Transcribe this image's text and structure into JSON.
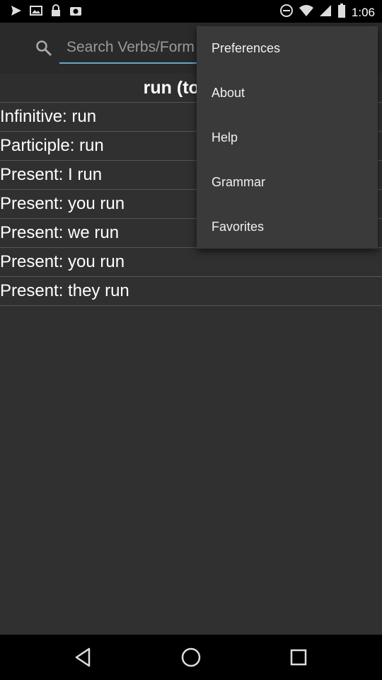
{
  "status_bar": {
    "time": "1:06"
  },
  "search": {
    "placeholder": "Search Verbs/Forms"
  },
  "header": {
    "verb_title": "run (to run)"
  },
  "conjugations": [
    "Infinitive: run",
    "Participle: run",
    "Present: I run",
    "Present: you run",
    "Present: we run",
    "Present: you run",
    "Present: they run"
  ],
  "menu": {
    "items": [
      "Preferences",
      "About",
      "Help",
      "Grammar",
      "Favorites"
    ]
  },
  "colors": {
    "accent": "#6aa7c9",
    "background": "#303030",
    "menu_bg": "#3a3a3a"
  }
}
